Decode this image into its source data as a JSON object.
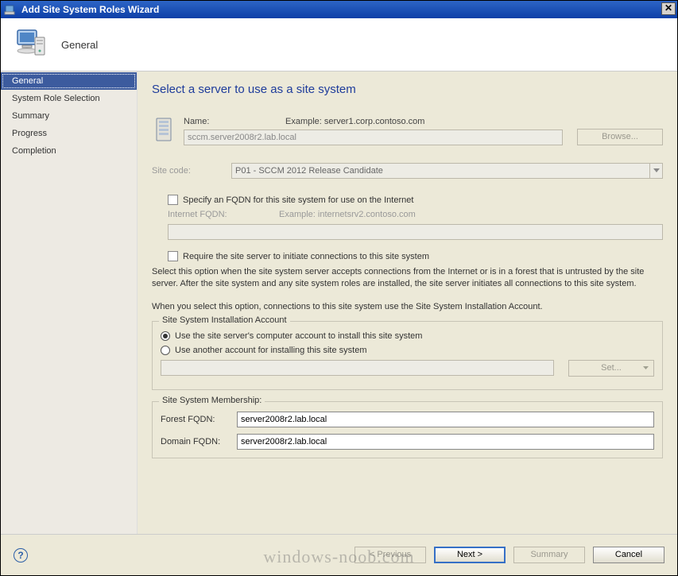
{
  "window": {
    "title": "Add Site System Roles Wizard"
  },
  "header": {
    "step_label": "General"
  },
  "sidebar": {
    "steps": [
      {
        "label": "General"
      },
      {
        "label": "System Role Selection"
      },
      {
        "label": "Summary"
      },
      {
        "label": "Progress"
      },
      {
        "label": "Completion"
      }
    ]
  },
  "content": {
    "title": "Select a server to use as a site system",
    "name_label": "Name:",
    "name_example": "Example: server1.corp.contoso.com",
    "name_value": "sccm.server2008r2.lab.local",
    "browse_label": "Browse...",
    "site_code_label": "Site code:",
    "site_code_value": "P01 - SCCM 2012 Release Candidate",
    "fqdn_checkbox_label": "Specify an FQDN for this site system for use on the Internet",
    "internet_fqdn_label": "Internet FQDN:",
    "internet_fqdn_example": "Example: internetsrv2.contoso.com",
    "internet_fqdn_value": "",
    "require_checkbox_label": "Require the site server to initiate connections to this site system",
    "require_desc": "Select this option when the site system server accepts connections from the Internet or is in a forest that is untrusted by the site server. After the site system and any site system roles are installed, the site server initiates all connections to this site system.",
    "note_text": "When you select this option, connections to this site system use the Site System Installation Account.",
    "install_group_title": "Site System Installation Account",
    "radio_use_server": "Use the site server's computer account to install this site system",
    "radio_use_other": "Use another account for installing this site system",
    "other_account_value": "",
    "set_label": "Set...",
    "membership_group_title": "Site System Membership:",
    "forest_fqdn_label": "Forest FQDN:",
    "forest_fqdn_value": "server2008r2.lab.local",
    "domain_fqdn_label": "Domain FQDN:",
    "domain_fqdn_value": "server2008r2.lab.local"
  },
  "footer": {
    "previous": "< Previous",
    "next": "Next >",
    "summary": "Summary",
    "cancel": "Cancel"
  },
  "watermark": "windows-noob.com"
}
